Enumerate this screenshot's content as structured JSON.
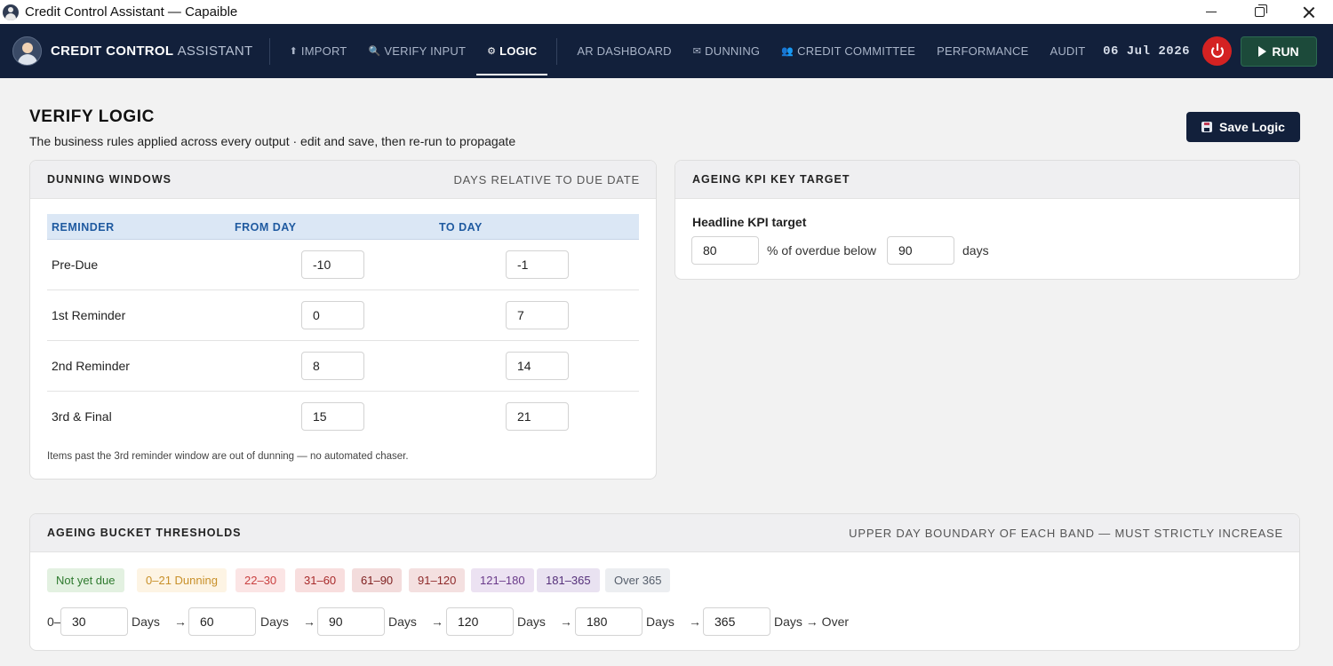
{
  "window": {
    "title": "Credit Control Assistant — Capaible"
  },
  "brand": {
    "name": "CREDIT CONTROL",
    "suffix": "ASSISTANT"
  },
  "nav": {
    "items": [
      {
        "icon": "⬆",
        "label": "IMPORT"
      },
      {
        "icon": "🔍",
        "label": "VERIFY INPUT"
      },
      {
        "icon": "⚙",
        "label": "LOGIC"
      },
      {
        "icon": "",
        "label": "AR DASHBOARD"
      },
      {
        "icon": "✉",
        "label": "DUNNING"
      },
      {
        "icon": "👥",
        "label": "CREDIT COMMITTEE"
      },
      {
        "icon": "",
        "label": "PERFORMANCE"
      },
      {
        "icon": "",
        "label": "AUDIT"
      }
    ],
    "active": "LOGIC",
    "date": "06 Jul 2026",
    "run_label": "RUN"
  },
  "page": {
    "title": "VERIFY LOGIC",
    "subtitle": "The business rules applied across every output · edit and save, then re-run to propagate",
    "save_label": "Save Logic"
  },
  "dunning": {
    "title": "DUNNING WINDOWS",
    "meta": "DAYS RELATIVE TO DUE DATE",
    "headers": [
      "REMINDER",
      "FROM DAY",
      "TO DAY"
    ],
    "rows": [
      {
        "name": "Pre-Due",
        "from": "-10",
        "to": "-1"
      },
      {
        "name": "1st Reminder",
        "from": "0",
        "to": "7"
      },
      {
        "name": "2nd Reminder",
        "from": "8",
        "to": "14"
      },
      {
        "name": "3rd & Final",
        "from": "15",
        "to": "21"
      }
    ],
    "note": "Items past the 3rd reminder window are out of dunning — no automated chaser."
  },
  "kpi": {
    "title": "AGEING KPI KEY TARGET",
    "label": "Headline KPI target",
    "percent": "80",
    "mid_text": "% of overdue below",
    "days": "90",
    "days_text": "days"
  },
  "ageing": {
    "title": "AGEING BUCKET THRESHOLDS",
    "meta": "UPPER DAY BOUNDARY OF EACH BAND — MUST STRICTLY INCREASE",
    "chips": [
      {
        "label": "Not yet due",
        "bg": "#e3f1e1",
        "fg": "#2e7a2e"
      },
      {
        "label": "0–21 Dunning",
        "bg": "#fdf4e4",
        "fg": "#c8902a"
      },
      {
        "label": "22–30",
        "bg": "#fbe5e5",
        "fg": "#c94040"
      },
      {
        "label": "31–60",
        "bg": "#f8dede",
        "fg": "#a82a2a"
      },
      {
        "label": "61–90",
        "bg": "#f3dcdc",
        "fg": "#7e1f1f"
      },
      {
        "label": "91–120",
        "bg": "#f4e0e0",
        "fg": "#8e2a2a"
      },
      {
        "label": "121–180",
        "bg": "#ece2f2",
        "fg": "#6a3a8a"
      },
      {
        "label": "181–365",
        "bg": "#e9e2f1",
        "fg": "#55307a"
      },
      {
        "label": "Over 365",
        "bg": "#eceef1",
        "fg": "#555e6b"
      }
    ],
    "prefix": "0–",
    "thresholds": [
      "30",
      "60",
      "90",
      "120",
      "180",
      "365"
    ],
    "unit": "Days",
    "arrow": "→",
    "final": "Days → Over"
  }
}
